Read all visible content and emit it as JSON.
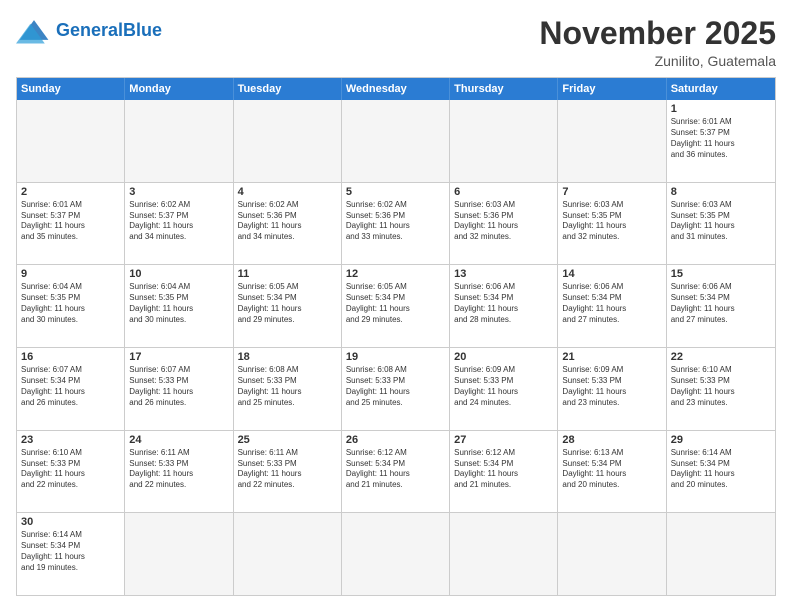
{
  "header": {
    "logo_general": "General",
    "logo_blue": "Blue",
    "month_title": "November 2025",
    "location": "Zunilito, Guatemala"
  },
  "days_of_week": [
    "Sunday",
    "Monday",
    "Tuesday",
    "Wednesday",
    "Thursday",
    "Friday",
    "Saturday"
  ],
  "weeks": [
    [
      {
        "day": "",
        "info": ""
      },
      {
        "day": "",
        "info": ""
      },
      {
        "day": "",
        "info": ""
      },
      {
        "day": "",
        "info": ""
      },
      {
        "day": "",
        "info": ""
      },
      {
        "day": "",
        "info": ""
      },
      {
        "day": "1",
        "info": "Sunrise: 6:01 AM\nSunset: 5:37 PM\nDaylight: 11 hours\nand 36 minutes."
      }
    ],
    [
      {
        "day": "2",
        "info": "Sunrise: 6:01 AM\nSunset: 5:37 PM\nDaylight: 11 hours\nand 35 minutes."
      },
      {
        "day": "3",
        "info": "Sunrise: 6:02 AM\nSunset: 5:37 PM\nDaylight: 11 hours\nand 34 minutes."
      },
      {
        "day": "4",
        "info": "Sunrise: 6:02 AM\nSunset: 5:36 PM\nDaylight: 11 hours\nand 34 minutes."
      },
      {
        "day": "5",
        "info": "Sunrise: 6:02 AM\nSunset: 5:36 PM\nDaylight: 11 hours\nand 33 minutes."
      },
      {
        "day": "6",
        "info": "Sunrise: 6:03 AM\nSunset: 5:36 PM\nDaylight: 11 hours\nand 32 minutes."
      },
      {
        "day": "7",
        "info": "Sunrise: 6:03 AM\nSunset: 5:35 PM\nDaylight: 11 hours\nand 32 minutes."
      },
      {
        "day": "8",
        "info": "Sunrise: 6:03 AM\nSunset: 5:35 PM\nDaylight: 11 hours\nand 31 minutes."
      }
    ],
    [
      {
        "day": "9",
        "info": "Sunrise: 6:04 AM\nSunset: 5:35 PM\nDaylight: 11 hours\nand 30 minutes."
      },
      {
        "day": "10",
        "info": "Sunrise: 6:04 AM\nSunset: 5:35 PM\nDaylight: 11 hours\nand 30 minutes."
      },
      {
        "day": "11",
        "info": "Sunrise: 6:05 AM\nSunset: 5:34 PM\nDaylight: 11 hours\nand 29 minutes."
      },
      {
        "day": "12",
        "info": "Sunrise: 6:05 AM\nSunset: 5:34 PM\nDaylight: 11 hours\nand 29 minutes."
      },
      {
        "day": "13",
        "info": "Sunrise: 6:06 AM\nSunset: 5:34 PM\nDaylight: 11 hours\nand 28 minutes."
      },
      {
        "day": "14",
        "info": "Sunrise: 6:06 AM\nSunset: 5:34 PM\nDaylight: 11 hours\nand 27 minutes."
      },
      {
        "day": "15",
        "info": "Sunrise: 6:06 AM\nSunset: 5:34 PM\nDaylight: 11 hours\nand 27 minutes."
      }
    ],
    [
      {
        "day": "16",
        "info": "Sunrise: 6:07 AM\nSunset: 5:34 PM\nDaylight: 11 hours\nand 26 minutes."
      },
      {
        "day": "17",
        "info": "Sunrise: 6:07 AM\nSunset: 5:33 PM\nDaylight: 11 hours\nand 26 minutes."
      },
      {
        "day": "18",
        "info": "Sunrise: 6:08 AM\nSunset: 5:33 PM\nDaylight: 11 hours\nand 25 minutes."
      },
      {
        "day": "19",
        "info": "Sunrise: 6:08 AM\nSunset: 5:33 PM\nDaylight: 11 hours\nand 25 minutes."
      },
      {
        "day": "20",
        "info": "Sunrise: 6:09 AM\nSunset: 5:33 PM\nDaylight: 11 hours\nand 24 minutes."
      },
      {
        "day": "21",
        "info": "Sunrise: 6:09 AM\nSunset: 5:33 PM\nDaylight: 11 hours\nand 23 minutes."
      },
      {
        "day": "22",
        "info": "Sunrise: 6:10 AM\nSunset: 5:33 PM\nDaylight: 11 hours\nand 23 minutes."
      }
    ],
    [
      {
        "day": "23",
        "info": "Sunrise: 6:10 AM\nSunset: 5:33 PM\nDaylight: 11 hours\nand 22 minutes."
      },
      {
        "day": "24",
        "info": "Sunrise: 6:11 AM\nSunset: 5:33 PM\nDaylight: 11 hours\nand 22 minutes."
      },
      {
        "day": "25",
        "info": "Sunrise: 6:11 AM\nSunset: 5:33 PM\nDaylight: 11 hours\nand 22 minutes."
      },
      {
        "day": "26",
        "info": "Sunrise: 6:12 AM\nSunset: 5:34 PM\nDaylight: 11 hours\nand 21 minutes."
      },
      {
        "day": "27",
        "info": "Sunrise: 6:12 AM\nSunset: 5:34 PM\nDaylight: 11 hours\nand 21 minutes."
      },
      {
        "day": "28",
        "info": "Sunrise: 6:13 AM\nSunset: 5:34 PM\nDaylight: 11 hours\nand 20 minutes."
      },
      {
        "day": "29",
        "info": "Sunrise: 6:14 AM\nSunset: 5:34 PM\nDaylight: 11 hours\nand 20 minutes."
      }
    ],
    [
      {
        "day": "30",
        "info": "Sunrise: 6:14 AM\nSunset: 5:34 PM\nDaylight: 11 hours\nand 19 minutes."
      },
      {
        "day": "",
        "info": ""
      },
      {
        "day": "",
        "info": ""
      },
      {
        "day": "",
        "info": ""
      },
      {
        "day": "",
        "info": ""
      },
      {
        "day": "",
        "info": ""
      },
      {
        "day": "",
        "info": ""
      }
    ]
  ]
}
